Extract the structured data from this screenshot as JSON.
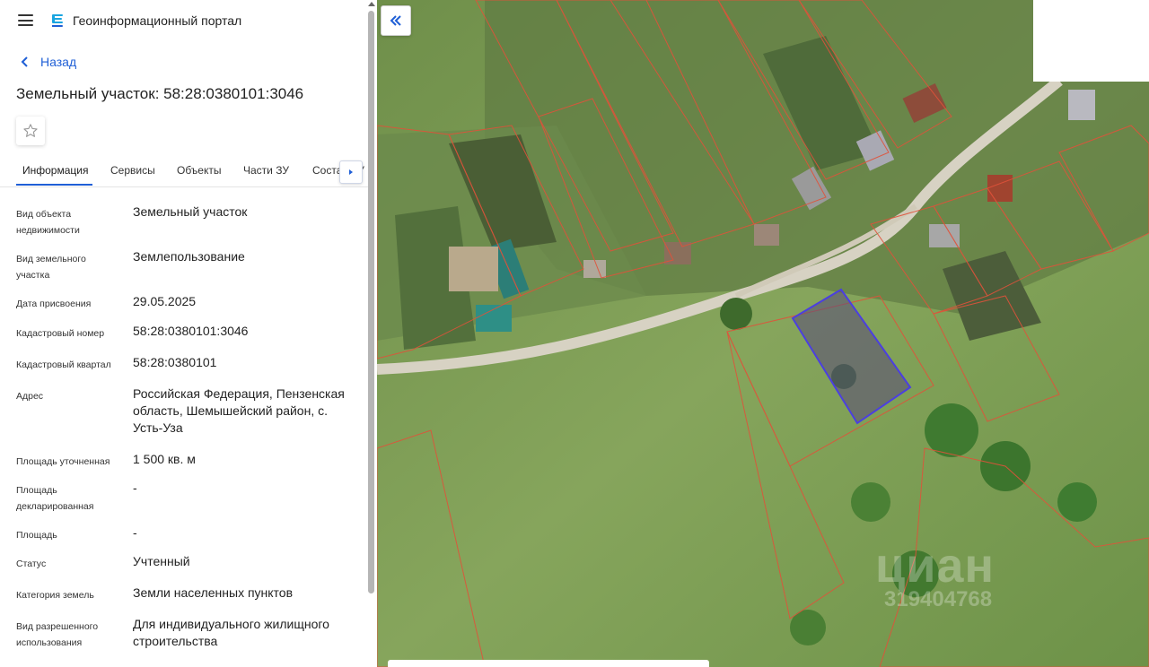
{
  "header": {
    "app_title": "Геоинформационный портал",
    "menu_icon": "menu-icon",
    "logo_icon": "portal-logo-icon"
  },
  "nav": {
    "back_label": "Назад"
  },
  "object": {
    "title": "Земельный участок: 58:28:0380101:3046",
    "favorite_icon": "star-icon"
  },
  "tabs": [
    {
      "label": "Информация",
      "active": true
    },
    {
      "label": "Сервисы",
      "active": false
    },
    {
      "label": "Объекты",
      "active": false
    },
    {
      "label": "Части ЗУ",
      "active": false
    },
    {
      "label": "Состав ЗУ",
      "active": false
    }
  ],
  "fields": [
    {
      "label": "Вид объекта недвижимости",
      "value": "Земельный участок"
    },
    {
      "label": "Вид земельного участка",
      "value": "Землепользование"
    },
    {
      "label": "Дата присвоения",
      "value": "29.05.2025"
    },
    {
      "label": "Кадастровый номер",
      "value": "58:28:0380101:3046"
    },
    {
      "label": "Кадастровый квартал",
      "value": "58:28:0380101"
    },
    {
      "label": "Адрес",
      "value": "Российская Федерация, Пензенская область, Шемышейский район, с. Усть-Уза"
    },
    {
      "label": "Площадь уточненная",
      "value": "1 500 кв. м"
    },
    {
      "label": "Площадь декларированная",
      "value": "-"
    },
    {
      "label": "Площадь",
      "value": "-"
    },
    {
      "label": "Статус",
      "value": "Учтенный"
    },
    {
      "label": "Категория земель",
      "value": "Земли населенных пунктов"
    },
    {
      "label": "Вид разрешенного использования",
      "value": "Для индивидуального жилищного строительства"
    }
  ],
  "map": {
    "collapse_icon": "double-chevron-left-icon",
    "watermark": "циан",
    "watermark_id": "319404768",
    "colors": {
      "parcel_border": "#e0523a",
      "selected_parcel": "#4b3fe0",
      "road": "#d7d2c3"
    }
  },
  "colors": {
    "accent": "#1f5fd6"
  }
}
